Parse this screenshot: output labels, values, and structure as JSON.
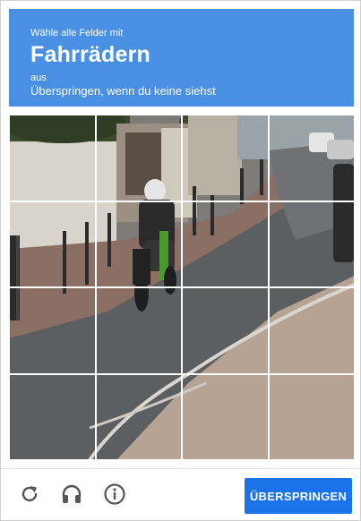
{
  "header": {
    "instruction": "Wähle alle Felder mit",
    "target": "Fahrrädern",
    "sub": "aus",
    "skip_note": "Überspringen, wenn du keine siehst"
  },
  "grid": {
    "rows": 4,
    "cols": 4
  },
  "footer": {
    "reload_icon": "reload-icon",
    "audio_icon": "headphones-icon",
    "info_icon": "info-icon",
    "skip_label": "ÜBERSPRINGEN"
  },
  "colors": {
    "header_bg": "#4a90e2",
    "skip_button": "#1a73e8",
    "footer_icon": "#555555"
  }
}
